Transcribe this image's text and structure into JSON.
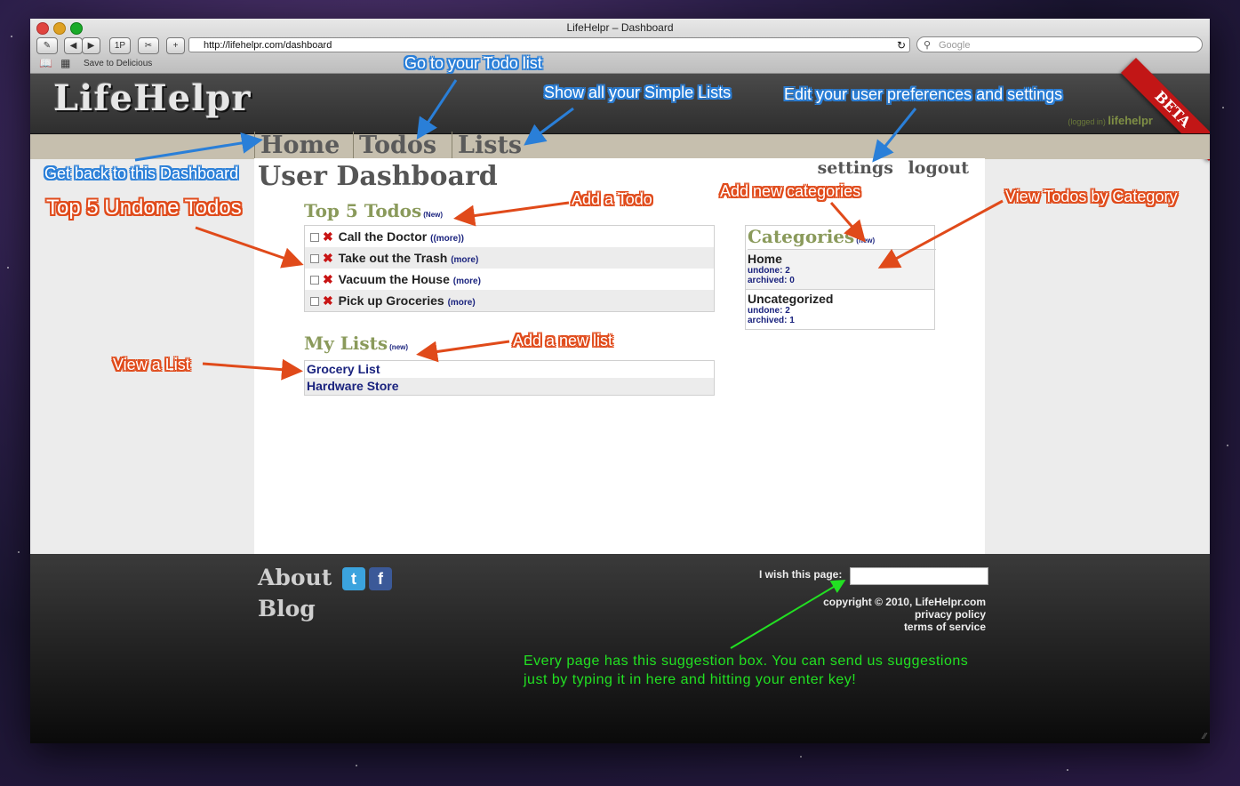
{
  "browser": {
    "title": "LifeHelpr – Dashboard",
    "url": "http://lifehelpr.com/dashboard",
    "search_placeholder": "Google",
    "bookmark": "Save to Delicious",
    "btn_1p": "1P",
    "btn_add": "+"
  },
  "site": {
    "logo": "LifeHelpr",
    "beta": "BETA",
    "logged_in_label": "(logged in)",
    "username": "lifehelpr",
    "nav": [
      "Home",
      "Todos",
      "Lists"
    ],
    "page_title": "User Dashboard",
    "settings": "settings",
    "logout": "logout"
  },
  "todos": {
    "title": "Top 5 Todos",
    "new_label": "(New)",
    "more_label": "(more)",
    "items": [
      "Call the Doctor",
      "Take out the Trash",
      "Vacuum the House",
      "Pick up Groceries"
    ]
  },
  "lists": {
    "title": "My Lists",
    "new_label": "(new)",
    "items": [
      "Grocery List",
      "Hardware Store"
    ]
  },
  "categories": {
    "title": "Categories",
    "new_label": "(new)",
    "items": [
      {
        "name": "Home",
        "undone": "undone: 2",
        "archived": "archived: 0"
      },
      {
        "name": "Uncategorized",
        "undone": "undone: 2",
        "archived": "archived: 1"
      }
    ]
  },
  "footer": {
    "about": "About",
    "blog": "Blog",
    "wish_label": "I wish this page:",
    "copyright": "copyright © 2010, LifeHelpr.com",
    "privacy": "privacy policy",
    "terms": "terms of service"
  },
  "annotations": {
    "todo_list": "Go to your Todo list",
    "simple_lists": "Show all your Simple Lists",
    "settings": "Edit your user preferences and settings",
    "dashboard": "Get back to this Dashboard",
    "top5": "Top 5 Undone Todos",
    "add_todo": "Add a Todo",
    "add_categories": "Add new categories",
    "view_by_category": "View Todos by Category",
    "add_list": "Add a new list",
    "view_list": "View a List",
    "suggestion_1": "Every page has this suggestion box. You can send us suggestions",
    "suggestion_2": "just by typing it in here and hitting your enter key!"
  },
  "colors": {
    "annotation_blue": "#2a7fd8",
    "annotation_red": "#e04a1a",
    "annotation_green": "#22e022",
    "section_title": "#8a9a5b",
    "link_blue": "#1a237e",
    "beta_red": "#c21616"
  }
}
